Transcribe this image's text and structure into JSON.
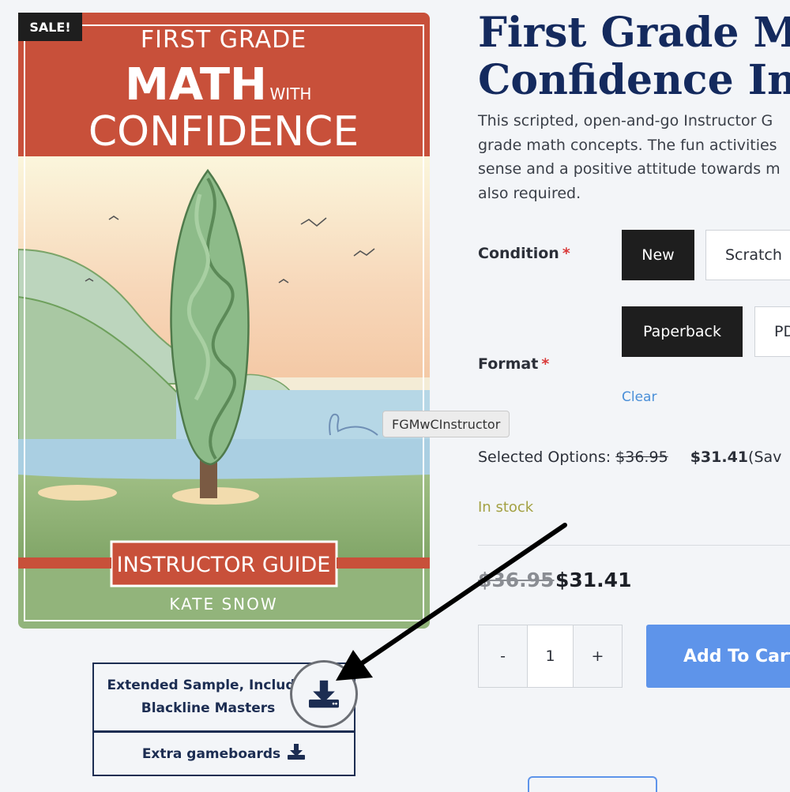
{
  "product": {
    "sale_badge": "SALE!",
    "title_line1": "First Grade Ma",
    "title_line2": "Confidence Ins",
    "description_lines": [
      "This scripted, open-and-go Instructor G",
      "grade math concepts. The fun activities",
      "sense and a positive attitude towards m",
      "also required."
    ]
  },
  "cover": {
    "top_line": "FIRST GRADE",
    "math": "MATH",
    "with": "WITH",
    "confidence": "CONFIDENCE",
    "banner": "INSTRUCTOR GUIDE",
    "author": "KATE SNOW"
  },
  "options": {
    "condition_label": "Condition",
    "format_label": "Format",
    "required_mark": "*",
    "condition_values": [
      "New",
      "Scratch"
    ],
    "format_values": [
      "Paperback",
      "PD"
    ],
    "clear": "Clear"
  },
  "tooltip": "FGMwCInstructor",
  "selected_options": {
    "label": "Selected Options:",
    "old_price": "$36.95",
    "new_price": "$31.41",
    "suffix": "(Sav"
  },
  "stock_status": "In stock",
  "price": {
    "old": "$36.95",
    "new": "$31.41"
  },
  "quantity": {
    "minus": "-",
    "value": "1",
    "plus": "+"
  },
  "add_to_cart": "Add To Cart",
  "downloads": {
    "extended_line1": "Extended Sample, Includin",
    "extended_line2": "Blackline Masters",
    "gameboards": "Extra gameboards"
  },
  "colors": {
    "brand_navy": "#142a5e",
    "cart_blue": "#5e94ea",
    "selected_black": "#1e1e1e",
    "stock_olive": "#a3a143",
    "required_red": "#d93a3a",
    "cover_red": "#c8503a"
  },
  "icons": [
    "download-icon",
    "arrow-annotation"
  ]
}
